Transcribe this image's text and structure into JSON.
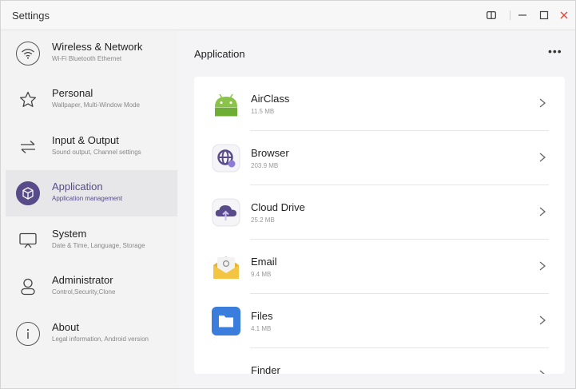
{
  "window": {
    "title": "Settings",
    "controls": {
      "split": "split-view-icon",
      "minimize": "minimize-icon",
      "maximize": "maximize-icon",
      "close": "close-icon"
    },
    "close_color": "#e0453a"
  },
  "sidebar": {
    "accent": "#574b89",
    "items": [
      {
        "label": "Wireless & Network",
        "sub": "Wi-Fi Bluetooth Ethernet",
        "icon": "wifi-icon",
        "active": false
      },
      {
        "label": "Personal",
        "sub": "Wallpaper, Multi-Window Mode",
        "icon": "star-icon",
        "active": false
      },
      {
        "label": "Input & Output",
        "sub": "Sound output, Channel settings",
        "icon": "swap-arrows-icon",
        "active": false
      },
      {
        "label": "Application",
        "sub": "Application management",
        "icon": "cube-icon",
        "active": true
      },
      {
        "label": "System",
        "sub": "Date & Time, Language, Storage",
        "icon": "monitor-icon",
        "active": false
      },
      {
        "label": "Administrator",
        "sub": "Control,Security,Clone",
        "icon": "user-icon",
        "active": false
      },
      {
        "label": "About",
        "sub": "Legal information, Android version",
        "icon": "info-icon",
        "active": false
      }
    ]
  },
  "main": {
    "title": "Application",
    "more_icon": "more-horizontal-icon",
    "apps": [
      {
        "name": "AirClass",
        "size": "11.5 MB",
        "icon": "android-icon",
        "color": "#8bc34a"
      },
      {
        "name": "Browser",
        "size": "203.9 MB",
        "icon": "globe-icon",
        "color": "#574b89"
      },
      {
        "name": "Cloud Drive",
        "size": "25.2 MB",
        "icon": "cloud-upload-icon",
        "color": "#574b89"
      },
      {
        "name": "Email",
        "size": "9.4 MB",
        "icon": "envelope-icon",
        "color": "#f4c542"
      },
      {
        "name": "Files",
        "size": "4.1 MB",
        "icon": "folder-icon",
        "color": "#3b7ddd"
      },
      {
        "name": "Finder",
        "size": "",
        "icon": "finder-icon",
        "color": "#574b89"
      }
    ]
  }
}
